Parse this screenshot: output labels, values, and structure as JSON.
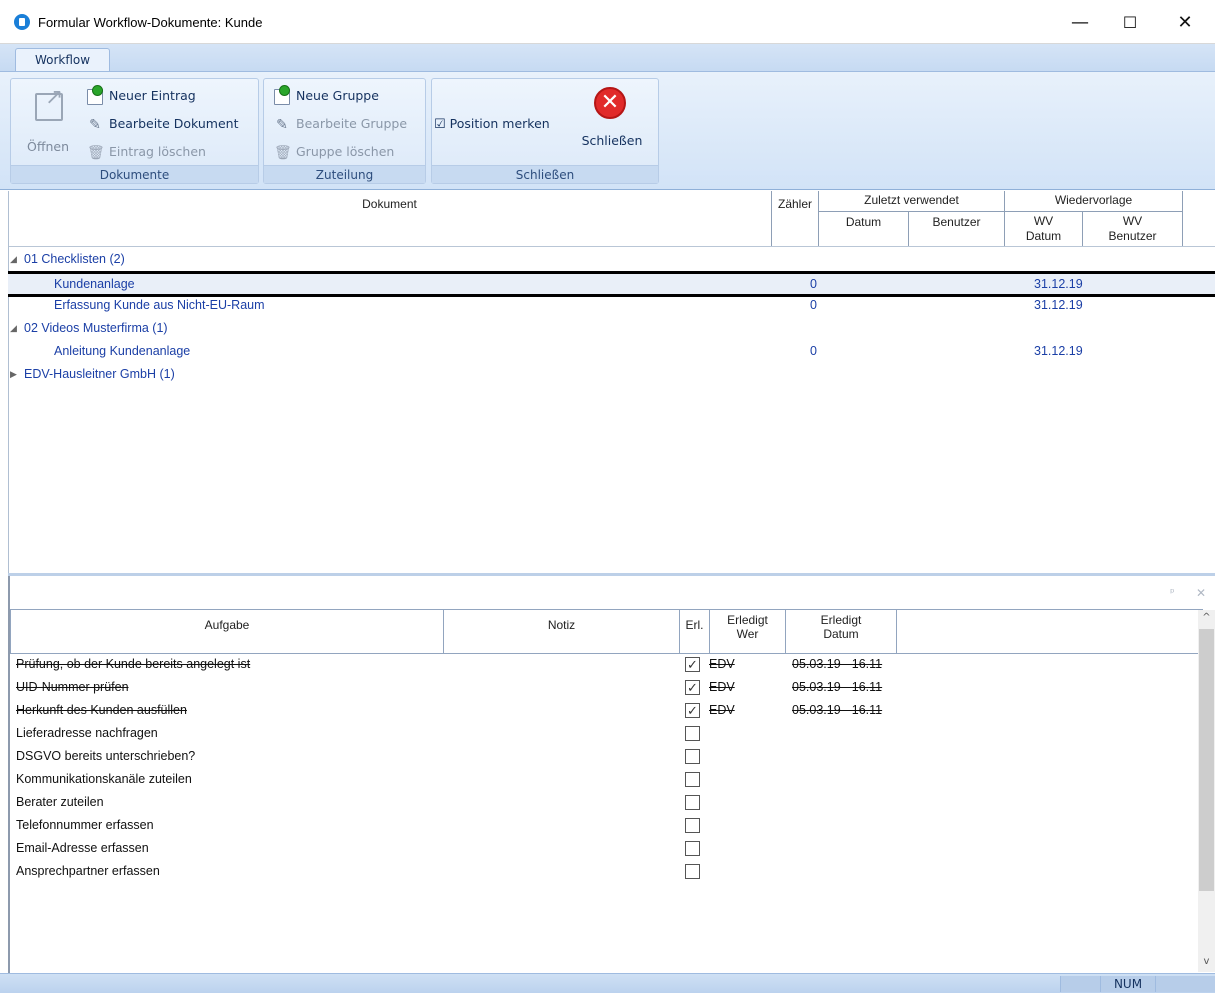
{
  "window": {
    "title": "Formular Workflow-Dokumente: Kunde",
    "minimize": "—",
    "maximize": "☐",
    "close": "✕"
  },
  "ribbon": {
    "tab": "Workflow",
    "groups": {
      "dokumente": {
        "label": "Dokumente",
        "open_label": "Öffnen",
        "new_entry": "Neuer Eintrag",
        "edit_doc": "Bearbeite Dokument",
        "delete_entry": "Eintrag löschen"
      },
      "zuteilung": {
        "label": "Zuteilung",
        "new_group": "Neue Gruppe",
        "edit_group": "Bearbeite Gruppe",
        "delete_group": "Gruppe löschen"
      },
      "schliessen": {
        "label": "Schließen",
        "position_check": "☑",
        "position_label": "Position merken",
        "close_label": "Schließen",
        "close_glyph": "✕"
      }
    }
  },
  "doc_table": {
    "headers": {
      "dokument": "Dokument",
      "zaehler": "Zähler",
      "zuletzt": "Zuletzt verwendet",
      "datum": "Datum",
      "benutzer": "Benutzer",
      "wiedervorlage": "Wiedervorlage",
      "wv_datum_1": "WV",
      "wv_datum_2": "Datum",
      "wv_benutzer_1": "WV",
      "wv_benutzer_2": "Benutzer"
    },
    "rows": [
      {
        "type": "group",
        "toggle": "◢",
        "label": "01 Checklisten (2)"
      },
      {
        "type": "item",
        "label": "Kundenanlage",
        "count": "0",
        "wv_date": "31.12.19",
        "selected": true
      },
      {
        "type": "item",
        "label": "Erfassung Kunde aus Nicht-EU-Raum",
        "count": "0",
        "wv_date": "31.12.19"
      },
      {
        "type": "group",
        "toggle": "◢",
        "label": "02 Videos Musterfirma (1)"
      },
      {
        "type": "item",
        "label": "Anleitung Kundenanlage",
        "count": "0",
        "wv_date": "31.12.19"
      },
      {
        "type": "group",
        "toggle": "▶",
        "label": "EDV-Hausleitner GmbH (1)"
      }
    ]
  },
  "task_pane": {
    "pin": "ᵖ",
    "close": "✕",
    "headers": {
      "aufgabe": "Aufgabe",
      "notiz": "Notiz",
      "erl": "Erl.",
      "erledigt_wer_1": "Erledigt",
      "erledigt_wer_2": "Wer",
      "erledigt_datum_1": "Erledigt",
      "erledigt_datum_2": "Datum"
    },
    "rows": [
      {
        "task": "Prüfung, ob der Kunde bereits angelegt ist",
        "done": true,
        "who": "EDV",
        "when": "05.03.19 - 16.11"
      },
      {
        "task": "UID-Nummer prüfen",
        "done": true,
        "who": "EDV",
        "when": "05.03.19 - 16.11"
      },
      {
        "task": "Herkunft des Kunden ausfüllen",
        "done": true,
        "who": "EDV",
        "when": "05.03.19 - 16.11"
      },
      {
        "task": "Lieferadresse nachfragen",
        "done": false,
        "who": "",
        "when": ""
      },
      {
        "task": "DSGVO bereits unterschrieben?",
        "done": false,
        "who": "",
        "when": ""
      },
      {
        "task": "Kommunikationskanäle zuteilen",
        "done": false,
        "who": "",
        "when": ""
      },
      {
        "task": "Berater zuteilen",
        "done": false,
        "who": "",
        "when": ""
      },
      {
        "task": "Telefonnummer erfassen",
        "done": false,
        "who": "",
        "when": ""
      },
      {
        "task": "Email-Adresse erfassen",
        "done": false,
        "who": "",
        "when": ""
      },
      {
        "task": "Ansprechpartner erfassen",
        "done": false,
        "who": "",
        "when": ""
      }
    ],
    "check_glyph": "✓",
    "scroll_up": "^",
    "scroll_down": "v"
  },
  "status_bar": {
    "num": "NUM"
  },
  "colors": {
    "ribbon_bg": "#d2e3f7",
    "link_blue": "#1b3fa6",
    "close_red": "#e12a2a",
    "new_green": "#2aa52a"
  },
  "icons": [
    "app-icon",
    "open-icon",
    "new-entry-icon",
    "edit-doc-icon",
    "trash-icon",
    "close-circle-icon",
    "pin-icon",
    "close-icon"
  ]
}
